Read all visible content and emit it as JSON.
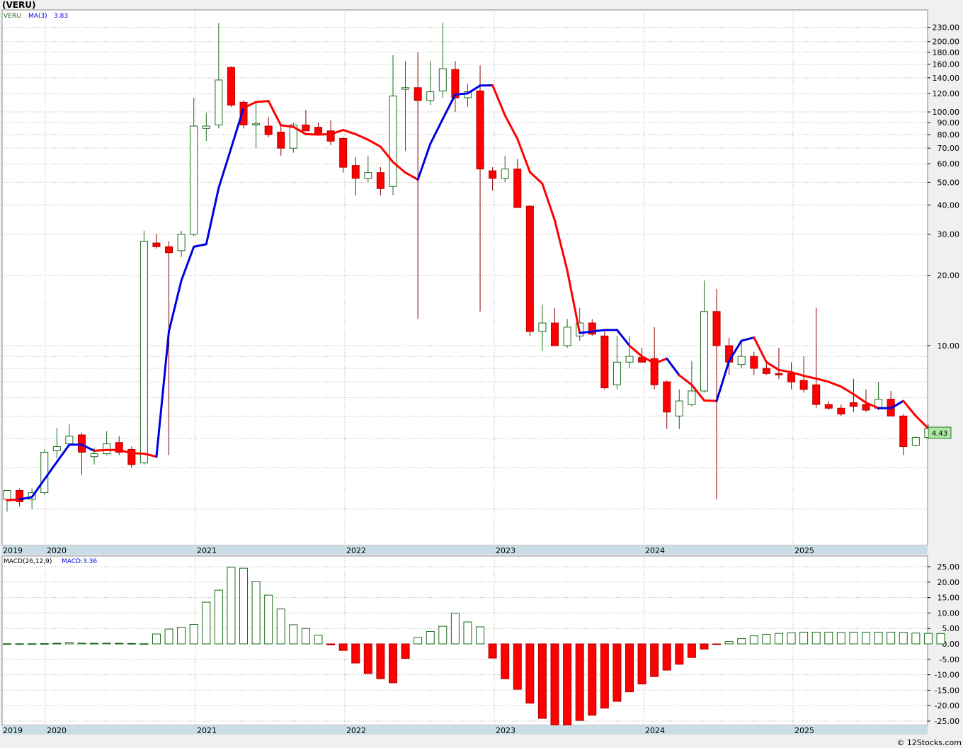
{
  "header": {
    "title": "(VERU)",
    "footer": "© 12Stocks.com"
  },
  "price_legend": {
    "symbol": "VERU",
    "ma_label": "MA(3)",
    "ma_value": "3.83"
  },
  "macd_legend": {
    "params": "MACD(26,12,9)",
    "value_label": "MACD:3.36"
  },
  "price_tag": "4.43",
  "colors": {
    "up": "#1a6b1a",
    "down": "#ff0000",
    "ma_up": "#0000e0",
    "ma_down": "#ff0000",
    "grid": "#b0b0b0",
    "axis_band": "#c8dde6"
  },
  "chart_data": [
    {
      "type": "candlestick",
      "x_axis": {
        "labels": [
          "2019",
          "2020",
          "2021",
          "2022",
          "2023",
          "2024",
          "2025"
        ]
      },
      "y_axis": {
        "scale": "log",
        "tick_labels": [
          "230.00",
          "200.00",
          "180.00",
          "160.00",
          "140.00",
          "120.00",
          "100.00",
          "90.00",
          "80.00",
          "70.00",
          "60.00",
          "50.00",
          "40.00",
          "30.00",
          "20.00",
          "10.00"
        ]
      },
      "candles": [
        {
          "o": 2.2,
          "h": 2.3,
          "l": 1.95,
          "c": 2.4
        },
        {
          "o": 2.4,
          "h": 2.45,
          "l": 2.05,
          "c": 2.15
        },
        {
          "o": 2.2,
          "h": 2.45,
          "l": 2.0,
          "c": 2.35
        },
        {
          "o": 2.35,
          "h": 3.6,
          "l": 2.3,
          "c": 3.5
        },
        {
          "o": 3.55,
          "h": 4.45,
          "l": 3.3,
          "c": 3.7
        },
        {
          "o": 3.8,
          "h": 4.6,
          "l": 3.7,
          "c": 4.1
        },
        {
          "o": 4.15,
          "h": 4.25,
          "l": 2.8,
          "c": 3.5
        },
        {
          "o": 3.35,
          "h": 3.65,
          "l": 3.1,
          "c": 3.45
        },
        {
          "o": 3.45,
          "h": 4.3,
          "l": 3.4,
          "c": 3.8
        },
        {
          "o": 3.85,
          "h": 4.1,
          "l": 3.4,
          "c": 3.5
        },
        {
          "o": 3.6,
          "h": 3.7,
          "l": 3.0,
          "c": 3.1
        },
        {
          "o": 3.15,
          "h": 31.0,
          "l": 3.1,
          "c": 28.0
        },
        {
          "o": 27.5,
          "h": 30.0,
          "l": 26.0,
          "c": 26.5
        },
        {
          "o": 26.5,
          "h": 28.0,
          "l": 3.4,
          "c": 25.0
        },
        {
          "o": 25.5,
          "h": 31.0,
          "l": 24.0,
          "c": 30.0
        },
        {
          "o": 30.0,
          "h": 115.0,
          "l": 29.5,
          "c": 87.0
        },
        {
          "o": 85.0,
          "h": 99.0,
          "l": 75.0,
          "c": 87.0
        },
        {
          "o": 88.0,
          "h": 240.0,
          "l": 85.0,
          "c": 137.0
        },
        {
          "o": 155.0,
          "h": 157.0,
          "l": 105.0,
          "c": 107.0
        },
        {
          "o": 110.0,
          "h": 112.0,
          "l": 85.0,
          "c": 88.0
        },
        {
          "o": 88.0,
          "h": 110.0,
          "l": 70.0,
          "c": 89.0
        },
        {
          "o": 87.0,
          "h": 95.0,
          "l": 78.0,
          "c": 80.0
        },
        {
          "o": 82.0,
          "h": 88.0,
          "l": 65.0,
          "c": 70.0
        },
        {
          "o": 70.0,
          "h": 90.0,
          "l": 67.0,
          "c": 88.0
        },
        {
          "o": 88.0,
          "h": 102.0,
          "l": 83.0,
          "c": 83.0
        },
        {
          "o": 86.0,
          "h": 90.0,
          "l": 80.0,
          "c": 80.0
        },
        {
          "o": 83.0,
          "h": 92.0,
          "l": 72.0,
          "c": 75.0
        },
        {
          "o": 77.0,
          "h": 78.0,
          "l": 55.0,
          "c": 58.0
        },
        {
          "o": 59.0,
          "h": 64.0,
          "l": 44.0,
          "c": 52.0
        },
        {
          "o": 52.0,
          "h": 65.0,
          "l": 50.0,
          "c": 55.0
        },
        {
          "o": 55.0,
          "h": 58.0,
          "l": 44.0,
          "c": 47.0
        },
        {
          "o": 48.0,
          "h": 175.0,
          "l": 44.0,
          "c": 117.0
        },
        {
          "o": 125.0,
          "h": 165.0,
          "l": 68.0,
          "c": 127.0
        },
        {
          "o": 127.0,
          "h": 180.0,
          "l": 13.0,
          "c": 112.0
        },
        {
          "o": 112.0,
          "h": 165.0,
          "l": 107.0,
          "c": 122.0
        },
        {
          "o": 123.0,
          "h": 240.0,
          "l": 115.0,
          "c": 153.0
        },
        {
          "o": 152.0,
          "h": 165.0,
          "l": 100.0,
          "c": 115.0
        },
        {
          "o": 115.0,
          "h": 132.0,
          "l": 105.0,
          "c": 122.0
        },
        {
          "o": 123.0,
          "h": 158.0,
          "l": 14.0,
          "c": 57.0
        },
        {
          "o": 56.0,
          "h": 58.0,
          "l": 46.0,
          "c": 52.0
        },
        {
          "o": 52.0,
          "h": 65.0,
          "l": 50.0,
          "c": 57.0
        },
        {
          "o": 57.0,
          "h": 63.0,
          "l": 39.0,
          "c": 39.0
        },
        {
          "o": 39.5,
          "h": 40.0,
          "l": 11.0,
          "c": 11.5
        },
        {
          "o": 11.5,
          "h": 15.0,
          "l": 9.5,
          "c": 12.5
        },
        {
          "o": 12.5,
          "h": 14.5,
          "l": 10.0,
          "c": 10.0
        },
        {
          "o": 10.0,
          "h": 13.0,
          "l": 9.8,
          "c": 12.0
        },
        {
          "o": 11.0,
          "h": 14.5,
          "l": 10.5,
          "c": 12.5
        },
        {
          "o": 12.5,
          "h": 13.0,
          "l": 11.0,
          "c": 11.2
        },
        {
          "o": 11.0,
          "h": 11.5,
          "l": 6.5,
          "c": 6.6
        },
        {
          "o": 6.8,
          "h": 11.0,
          "l": 6.5,
          "c": 8.5
        },
        {
          "o": 8.5,
          "h": 11.0,
          "l": 8.0,
          "c": 9.0
        },
        {
          "o": 8.9,
          "h": 9.8,
          "l": 8.5,
          "c": 8.5
        },
        {
          "o": 8.8,
          "h": 12.0,
          "l": 6.5,
          "c": 6.8
        },
        {
          "o": 7.0,
          "h": 7.1,
          "l": 4.4,
          "c": 5.2
        },
        {
          "o": 5.0,
          "h": 6.5,
          "l": 4.4,
          "c": 5.8
        },
        {
          "o": 5.6,
          "h": 8.6,
          "l": 5.5,
          "c": 6.4
        },
        {
          "o": 6.4,
          "h": 19.0,
          "l": 6.3,
          "c": 14.0
        },
        {
          "o": 14.0,
          "h": 17.5,
          "l": 2.2,
          "c": 10.0
        },
        {
          "o": 10.0,
          "h": 10.8,
          "l": 7.5,
          "c": 8.5
        },
        {
          "o": 8.3,
          "h": 10.5,
          "l": 8.0,
          "c": 9.0
        },
        {
          "o": 9.0,
          "h": 9.4,
          "l": 7.5,
          "c": 8.0
        },
        {
          "o": 8.0,
          "h": 8.5,
          "l": 7.5,
          "c": 7.6
        },
        {
          "o": 7.6,
          "h": 9.8,
          "l": 7.2,
          "c": 7.5
        },
        {
          "o": 7.6,
          "h": 8.5,
          "l": 6.5,
          "c": 7.0
        },
        {
          "o": 7.1,
          "h": 9.0,
          "l": 6.3,
          "c": 6.5
        },
        {
          "o": 6.8,
          "h": 14.5,
          "l": 5.4,
          "c": 5.6
        },
        {
          "o": 5.6,
          "h": 5.8,
          "l": 5.3,
          "c": 5.4
        },
        {
          "o": 5.4,
          "h": 5.6,
          "l": 5.0,
          "c": 5.1
        },
        {
          "o": 5.7,
          "h": 7.2,
          "l": 5.2,
          "c": 5.5
        },
        {
          "o": 5.6,
          "h": 6.5,
          "l": 5.2,
          "c": 5.3
        },
        {
          "o": 5.4,
          "h": 7.0,
          "l": 5.3,
          "c": 5.9
        },
        {
          "o": 5.9,
          "h": 6.4,
          "l": 5.0,
          "c": 5.0
        },
        {
          "o": 5.0,
          "h": 5.1,
          "l": 3.4,
          "c": 3.7
        },
        {
          "o": 3.75,
          "h": 4.1,
          "l": 3.7,
          "c": 4.05
        },
        {
          "o": 4.05,
          "h": 4.6,
          "l": 4.0,
          "c": 4.43
        }
      ],
      "ma3": [
        2.18,
        2.2,
        2.25,
        2.68,
        3.18,
        3.77,
        3.77,
        3.55,
        3.58,
        3.58,
        3.47,
        3.45,
        3.35,
        11.53,
        19.0,
        26.5,
        27.17,
        47.33,
        70.0,
        104.0,
        110.33,
        111.33,
        87.67,
        86.33,
        80.33,
        80.0,
        80.33,
        83.67,
        80.33,
        76.0,
        71.0,
        61.0,
        55.0,
        51.33,
        73.0,
        93.33,
        118.67,
        120.0,
        129.67,
        130.0,
        96.67,
        76.67,
        55.33,
        49.33,
        34.33,
        21.0,
        11.33,
        11.5,
        11.67,
        11.67,
        10.0,
        9.0,
        8.4,
        8.8,
        7.47,
        6.8,
        5.83,
        5.8,
        8.6,
        10.5,
        10.83,
        8.5,
        7.87,
        7.7,
        7.43,
        7.23,
        7.0,
        6.68,
        6.2,
        5.7,
        5.4,
        5.4,
        5.8,
        5.0,
        4.43,
        4.12
      ],
      "ma_state": [
        "up",
        "down",
        "up",
        "up",
        "up",
        "up",
        "up",
        "up",
        "down",
        "down",
        "down",
        "down",
        "down",
        "up",
        "up",
        "up",
        "up",
        "up",
        "up",
        "up",
        "down",
        "down",
        "down",
        "down",
        "down",
        "down",
        "down",
        "down",
        "down",
        "down",
        "down",
        "down",
        "down",
        "down",
        "up",
        "up",
        "up",
        "up",
        "up",
        "up",
        "down",
        "down",
        "down",
        "down",
        "down",
        "down",
        "down",
        "up",
        "up",
        "up",
        "up",
        "down",
        "down",
        "down",
        "up",
        "down",
        "down",
        "down",
        "up",
        "up",
        "up",
        "down",
        "down",
        "down",
        "down",
        "down",
        "down",
        "down",
        "down",
        "down",
        "down",
        "up",
        "up",
        "down",
        "down",
        "down",
        "down"
      ],
      "legend": [
        "VERU",
        "MA(3)"
      ]
    },
    {
      "type": "bar",
      "name": "MACD(26,12,9)",
      "x_axis": {
        "labels": [
          "2019",
          "2020",
          "2021",
          "2022",
          "2023",
          "2024",
          "2025"
        ]
      },
      "y_axis": {
        "tick_labels": [
          "25.00",
          "20.00",
          "15.00",
          "10.00",
          "5.00",
          "0.00",
          "-5.00",
          "-10.00",
          "-15.00",
          "-20.00",
          "-25.00"
        ],
        "ylim": [
          -27,
          27
        ]
      },
      "values": [
        0.05,
        0.05,
        0.05,
        0.1,
        0.2,
        0.35,
        0.25,
        0.2,
        0.25,
        0.2,
        0.15,
        0.05,
        3.2,
        4.8,
        5.4,
        6.3,
        13.5,
        17.4,
        24.8,
        24.5,
        20.2,
        15.8,
        11.3,
        6.2,
        5.0,
        2.8,
        -0.35,
        -2.1,
        -6.2,
        -9.6,
        -11.3,
        -12.6,
        -4.7,
        2.1,
        4.0,
        5.7,
        9.9,
        7.1,
        5.5,
        -4.6,
        -11.3,
        -14.7,
        -19.2,
        -24.1,
        -26.2,
        -26.3,
        -24.8,
        -23.1,
        -20.8,
        -18.6,
        -15.5,
        -13.0,
        -10.6,
        -8.5,
        -6.6,
        -4.4,
        -1.7,
        -0.2,
        0.8,
        1.7,
        2.6,
        3.1,
        3.4,
        3.6,
        3.8,
        3.8,
        3.8,
        3.7,
        3.8,
        3.8,
        3.8,
        3.8,
        3.7,
        3.5,
        3.4,
        3.36
      ]
    }
  ]
}
